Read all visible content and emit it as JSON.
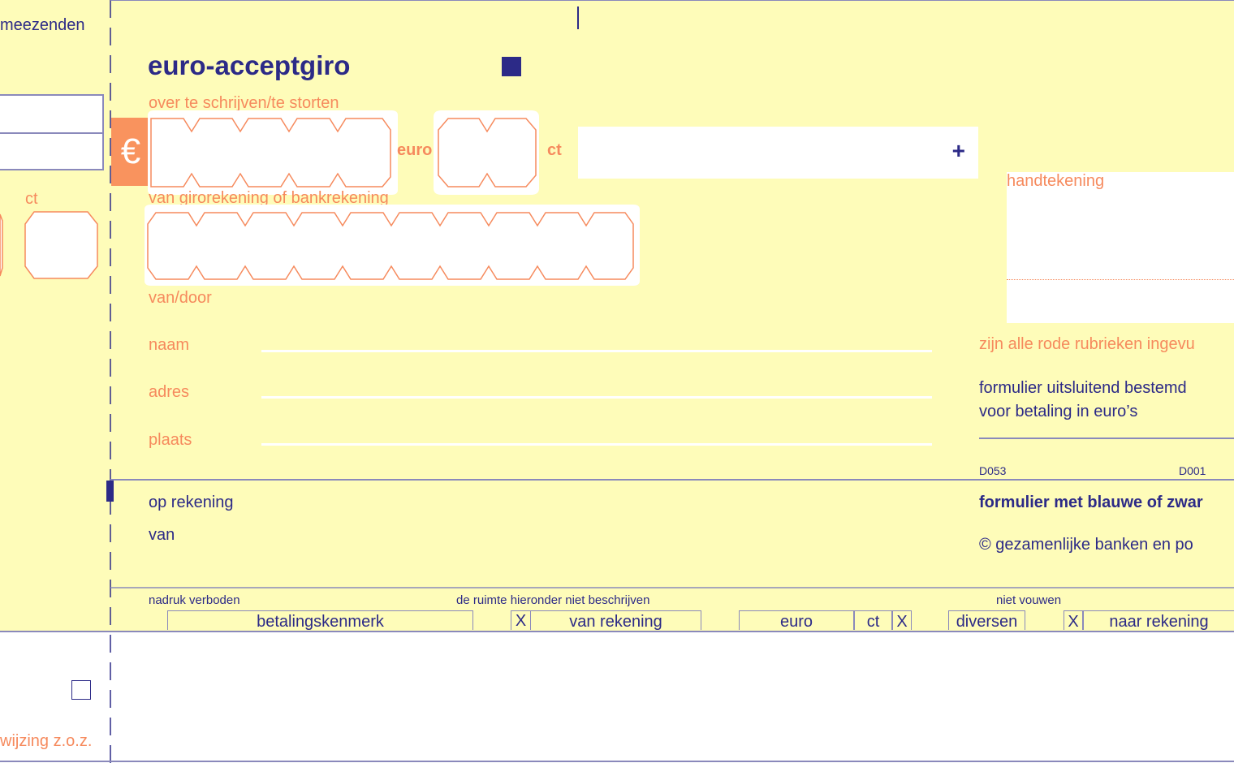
{
  "stub": {
    "top_text": "meezenden",
    "ct_label": "ct",
    "bottom_text": "wijzing z.o.z."
  },
  "header": {
    "title": "euro-acceptgiro"
  },
  "amount": {
    "label": "over te schrijven/te storten",
    "currency_symbol": "€",
    "euro_label": "euro",
    "ct_label": "ct",
    "plus_sign": "+"
  },
  "account": {
    "label": "van girorekening of bankrekening"
  },
  "sender": {
    "label": "van/door",
    "fields": [
      {
        "label": "naam"
      },
      {
        "label": "adres"
      },
      {
        "label": "plaats"
      }
    ]
  },
  "signature": {
    "label": "handtekening"
  },
  "notices": {
    "red_check": "zijn alle rode rubrieken ingevu",
    "euro_only_line1": "formulier uitsluitend bestemd",
    "euro_only_line2": "voor betaling in euro’s",
    "code_left": "D053",
    "code_right": "D001",
    "ink_notice": "formulier met blauwe of zwar",
    "copyright": "© gezamenlijke banken en po"
  },
  "beneficiary": {
    "on_account_label": "op rekening",
    "of_label": "van"
  },
  "footer": {
    "no_print": "nadruk verboden",
    "no_write": "de ruimte hieronder niet beschrijven",
    "no_fold": "niet vouwen",
    "cells": {
      "payment_ref": "betalingskenmerk",
      "from_account": "van rekening",
      "euro": "euro",
      "ct": "ct",
      "misc": "diversen",
      "to_account": "naar rekening"
    },
    "x_mark": "X"
  },
  "colors": {
    "form_background": "#fefcb9",
    "ink_blue": "#2c2a87",
    "ink_orange": "#f68a5d"
  }
}
